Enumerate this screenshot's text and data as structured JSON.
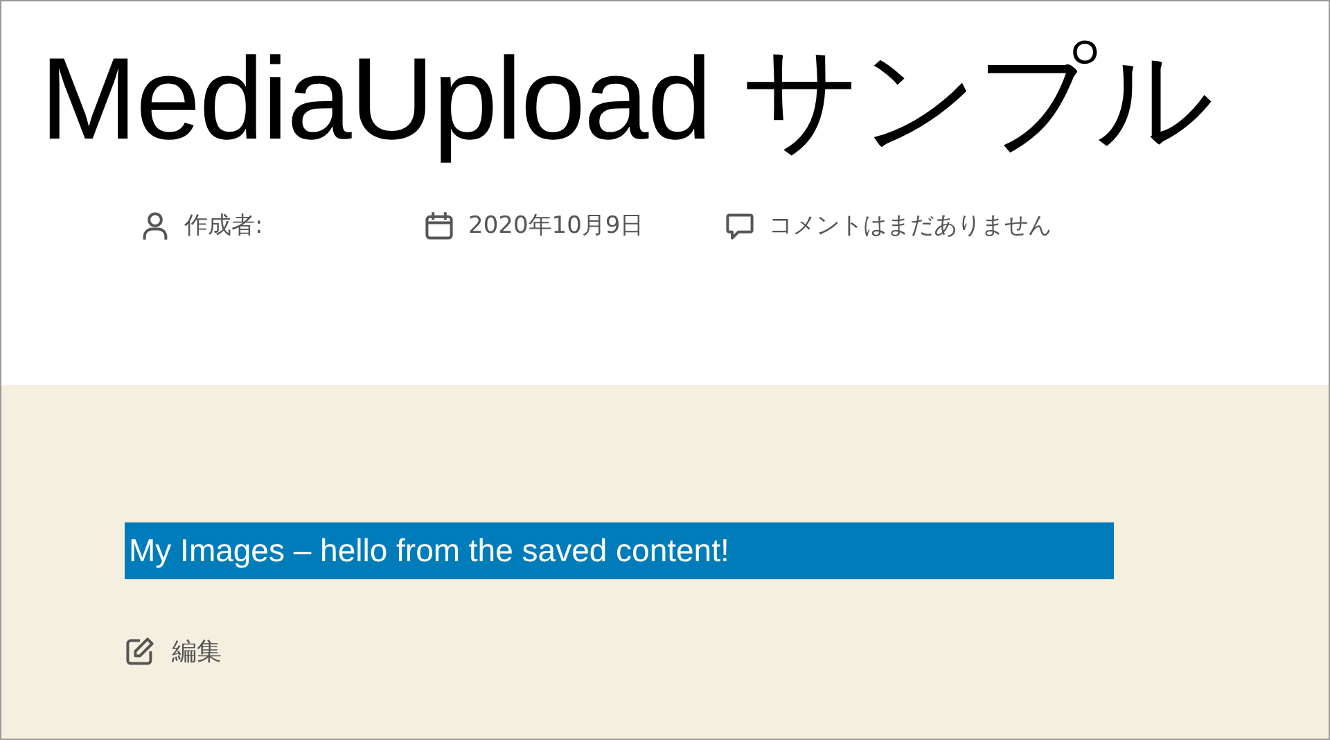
{
  "title": "MediaUpload サンプル",
  "meta": [
    {
      "kind": "author",
      "text": "作成者:"
    },
    {
      "kind": "date",
      "text": "2020年10月9日"
    },
    {
      "kind": "comments",
      "text": "コメントはまだありません"
    }
  ],
  "content": {
    "text": "My Images – hello from the saved content!"
  },
  "edit_link": {
    "text": "編集"
  }
}
